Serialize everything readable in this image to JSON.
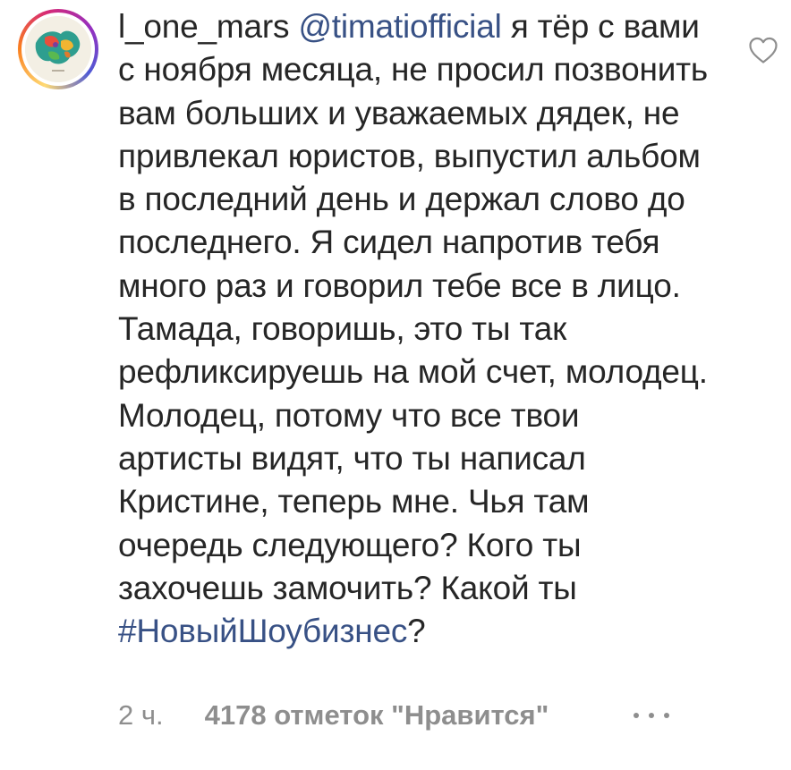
{
  "comment": {
    "username": "l_one_mars",
    "mention": "@timatiofficial",
    "text": " я тёр с вами с ноября месяца, не просил позвонить вам больших и уважаемых дядек, не привлекал юристов, выпустил альбом в последний день и держал слово до последнего. Я сидел напротив тебя много раз и говорил тебе все в лицо. Тамада, говоришь, это ты так рефликсируешь на мой счет, молодец. Молодец, потому что все твои артисты видят, что ты написал Кристине, теперь мне. Чья там очередь следующего? Кого ты захочешь замочить?  Какой ты ",
    "hashtag": "#НовыйШоубизнес",
    "tail": "?"
  },
  "meta": {
    "time": "2 ч.",
    "likes": "4178 отметок \"Нравится\""
  },
  "icons": {
    "like": "heart-outline-icon",
    "more": "more-dots-icon",
    "avatar": "avatar-image"
  },
  "colors": {
    "text": "#262626",
    "link": "#385185",
    "secondary": "#8e8e8e"
  }
}
